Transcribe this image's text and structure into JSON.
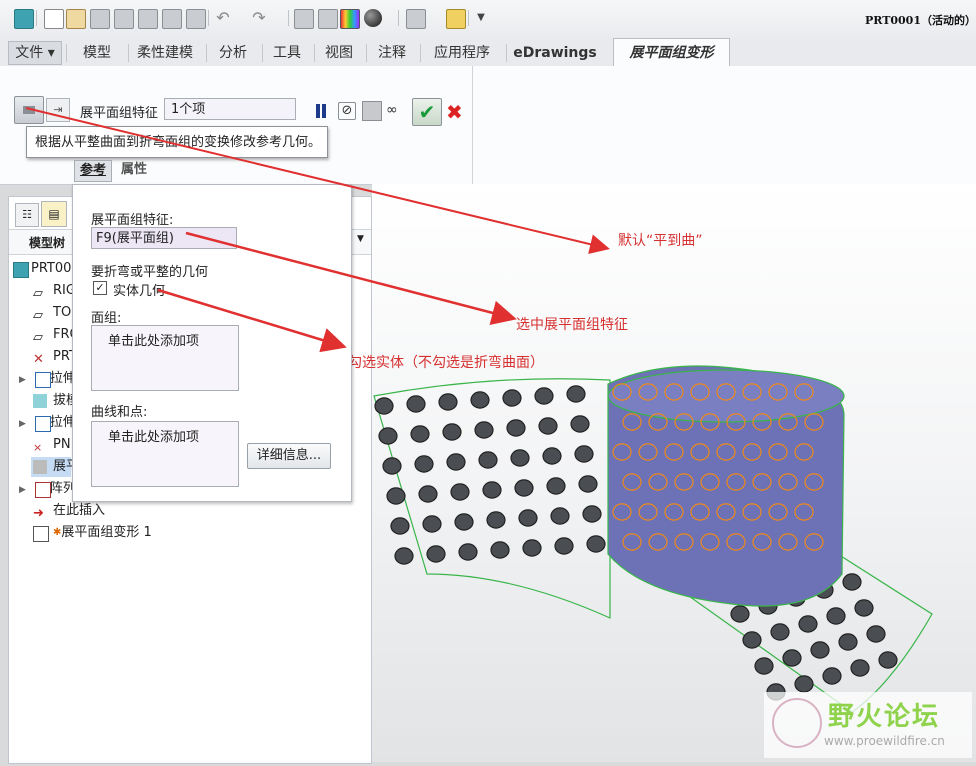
{
  "toolbar": {
    "doc_title": "PRT0001（活动的）"
  },
  "tabs": {
    "file": "文件",
    "items": [
      "模型",
      "柔性建模",
      "分析",
      "工具",
      "视图",
      "注释",
      "应用程序",
      "eDrawings"
    ],
    "active": "展平面组变形"
  },
  "ribbon": {
    "feature_label": "展平面组特征",
    "feature_value": "1个项",
    "tooltip": "根据从平整曲面到折弯面组的变换修改参考几何。",
    "subtab_ref": "参考",
    "subtab_props": "属性"
  },
  "tree": {
    "header_label": "模型树",
    "items": [
      "PRT00",
      "RIG",
      "TO",
      "FRO",
      "PRT",
      "拉伸",
      "拔模",
      "拉伸",
      "PN",
      "展平",
      "阵列",
      "在此插入",
      "展平面组变形 1"
    ]
  },
  "panel": {
    "feature_label": "展平面组特征:",
    "feature_value": "F9(展平面组)",
    "geom_label": "要折弯或平整的几何",
    "solid_label": "实体几何",
    "solid_checked": true,
    "quilt_label": "面组:",
    "quilt_placeholder": "单击此处添加项",
    "curves_label": "曲线和点:",
    "curves_placeholder": "单击此处添加项",
    "details_button": "详细信息..."
  },
  "annotations": {
    "default_dir": "默认“平到曲”",
    "select_feature": "选中展平面组特征",
    "check_solid": "勾选实体（不勾选是折弯曲面）"
  },
  "watermark": {
    "title": "野火论坛",
    "url": "www.proewildfire.cn"
  },
  "colors": {
    "annotation": "#d63030",
    "cylinder": "#6a6fb8",
    "pins": "#4a4d52",
    "orange_pins": "#f08a1a",
    "outline": "#39b54a"
  }
}
